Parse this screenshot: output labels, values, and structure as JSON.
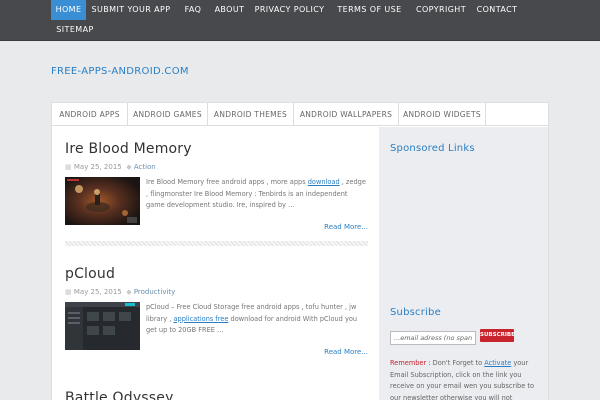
{
  "topnav": {
    "items": [
      {
        "label": "HOME",
        "active": true
      },
      {
        "label": "SUBMIT YOUR APP"
      },
      {
        "label": "FAQ"
      },
      {
        "label": "ABOUT"
      },
      {
        "label": "PRIVACY POLICY"
      },
      {
        "label": "TERMS OF USE"
      },
      {
        "label": "COPYRIGHT"
      },
      {
        "label": "CONTACT"
      },
      {
        "label": "SITEMAP"
      }
    ]
  },
  "site_title": "FREE-APPS-ANDROID.COM",
  "catnav": {
    "items": [
      "ANDROID APPS",
      "ANDROID GAMES",
      "ANDROID THEMES",
      "ANDROID WALLPAPERS",
      "ANDROID WIDGETS"
    ]
  },
  "posts": [
    {
      "title": "Ire Blood Memory",
      "date": "May 25, 2015",
      "category": "Action",
      "excerpt_a": "Ire Blood Memory free android apps , more apps ",
      "excerpt_link": "download",
      "excerpt_b": " , zedge , flingmonster Ire Blood Memory : Tenbirds is an independent game development studio. Ire, inspired by …",
      "read_more": "Read More..."
    },
    {
      "title": "pCloud",
      "date": "May 25, 2015",
      "category": "Productivity",
      "excerpt_a": "pCloud – Free Cloud Storage free android apps , tofu hunter , jw library , ",
      "excerpt_link": "applications free",
      "excerpt_b": " download for android With pCloud you get up to 20GB FREE …",
      "read_more": "Read More..."
    },
    {
      "title": "Battle Odyssey"
    }
  ],
  "sidebar": {
    "sponsored_heading": "Sponsored Links",
    "subscribe_heading": "Subscribe",
    "email_placeholder": "...email adress (no span",
    "subscribe_button": "SUBSCRIBE",
    "remember_label": "Remember :",
    "note_a": " Don't Forget to ",
    "note_link": "Activate",
    "note_b": " your Email Subscription, click on the link you receive on your email wen you subscribe to our newsletter otherwise you will not"
  },
  "colors": {
    "accent": "#2a7fc4",
    "topnav_bg": "#47494c",
    "active_tab": "#3a8fd4",
    "subscribe_red": "#c9232d",
    "page_bg": "#e9eaec"
  },
  "icons": {
    "date_icon": "calendar-icon",
    "category_icon": "tag-icon"
  }
}
